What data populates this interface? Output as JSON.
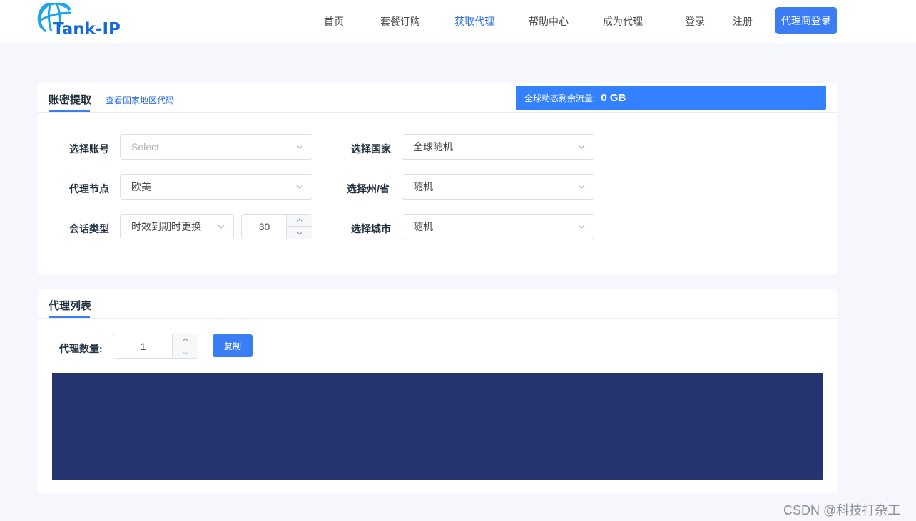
{
  "header": {
    "logo_text": "Tank-IP",
    "nav": [
      {
        "label": "首页"
      },
      {
        "label": "套餐订购"
      },
      {
        "label": "获取代理",
        "active": true
      },
      {
        "label": "帮助中心"
      },
      {
        "label": "成为代理"
      },
      {
        "label": "登录"
      },
      {
        "label": "注册"
      }
    ],
    "agent_login_label": "代理商登录"
  },
  "extract_panel": {
    "tab_title": "账密提取",
    "country_code_link": "查看国家地区代码",
    "traffic": {
      "label": "全球动态剩余流量:",
      "value": "0 GB"
    },
    "fields": {
      "account": {
        "label": "选择账号",
        "placeholder": "Select"
      },
      "country": {
        "label": "选择国家",
        "value": "全球随机"
      },
      "node": {
        "label": "代理节点",
        "value": "欧美"
      },
      "state": {
        "label": "选择州/省",
        "value": "随机"
      },
      "session": {
        "label": "会话类型",
        "value": "时效到期时更换",
        "minutes": "30"
      },
      "city": {
        "label": "选择城市",
        "value": "随机"
      }
    }
  },
  "list_panel": {
    "tab_title": "代理列表",
    "quantity_label": "代理数量:",
    "quantity_value": "1",
    "copy_label": "复制"
  },
  "watermark": "CSDN @科技打杂工",
  "colors": {
    "accent": "#3a7df5",
    "output_bg": "#25346e",
    "page_bg": "#f5f7fc"
  },
  "icons": [
    "globe-logo-icon",
    "chevron-down-icon",
    "chevron-up-icon"
  ]
}
